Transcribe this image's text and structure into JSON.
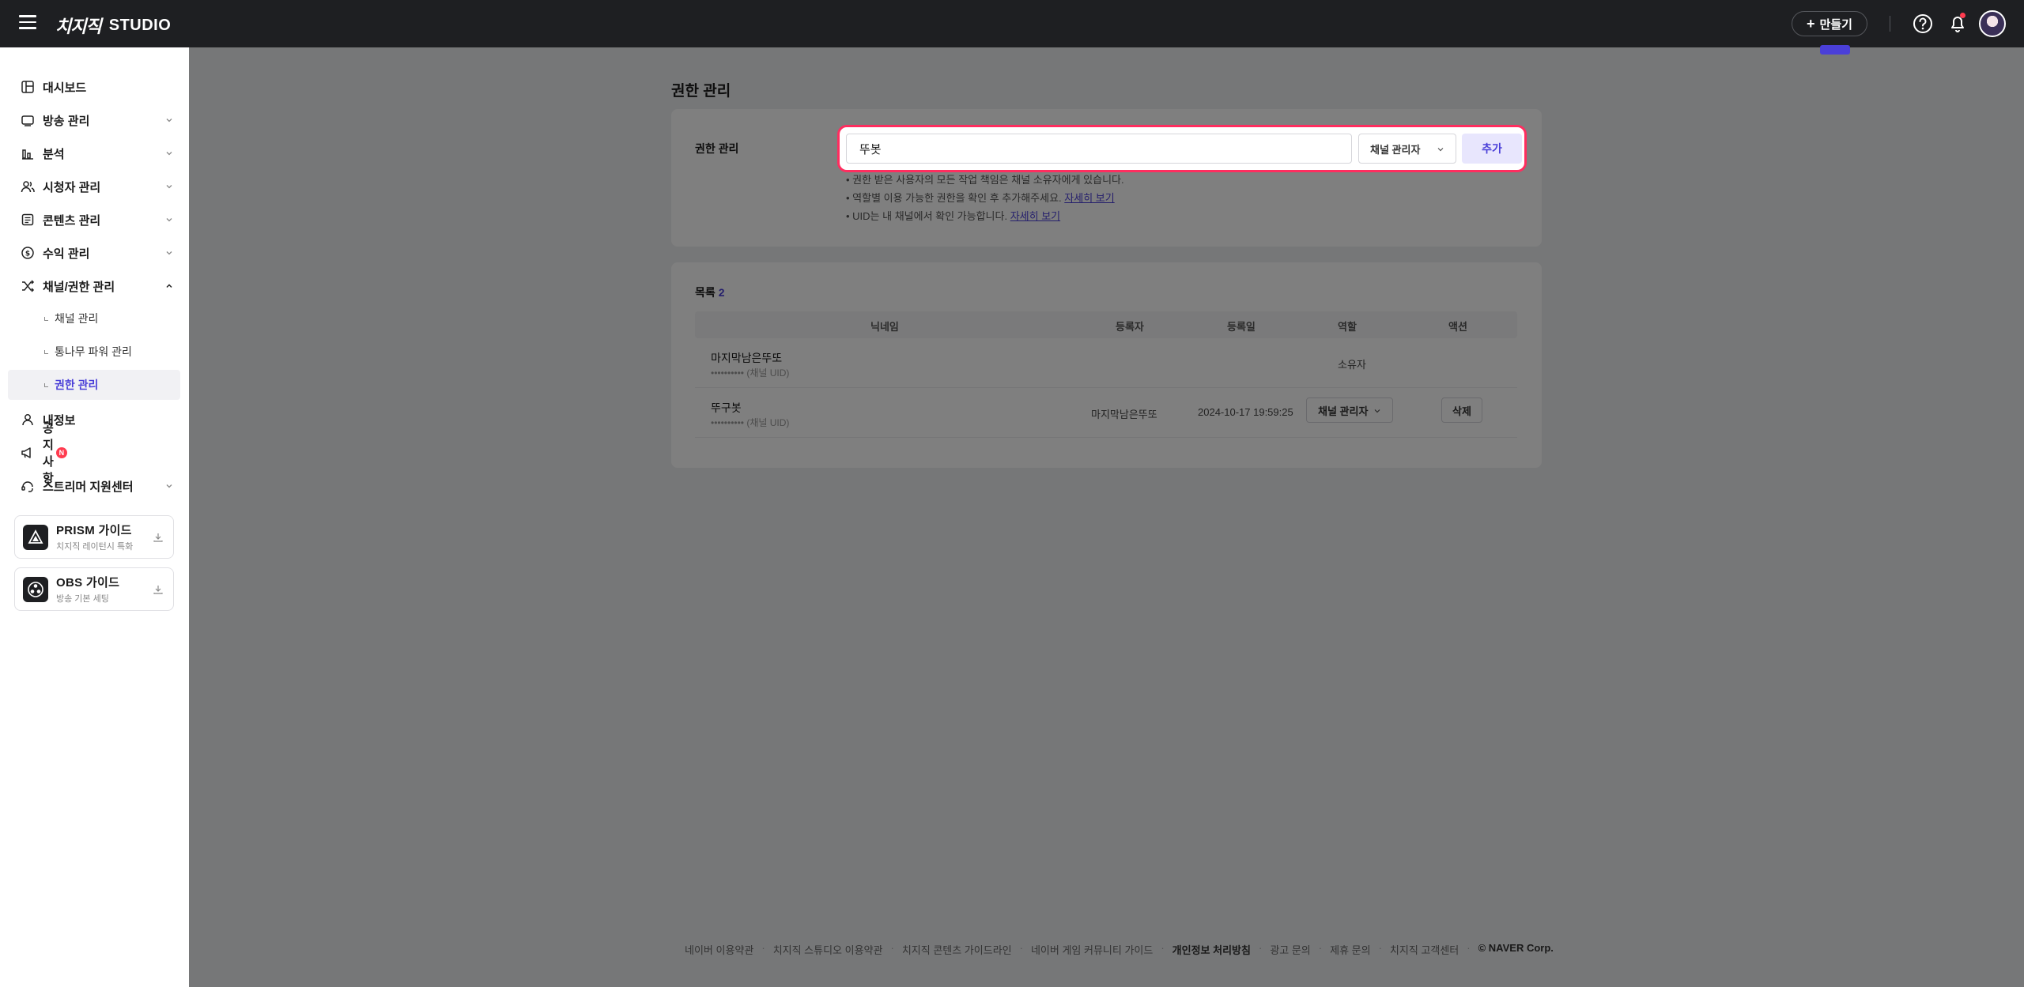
{
  "topbar": {
    "logo_mark": "치지직",
    "logo_studio": "STUDIO",
    "create_label": "만들기"
  },
  "sidebar": {
    "items": [
      {
        "label": "대시보드",
        "icon": "dashboard-icon"
      },
      {
        "label": "방송 관리",
        "icon": "broadcast-icon"
      },
      {
        "label": "분석",
        "icon": "analytics-icon"
      },
      {
        "label": "시청자 관리",
        "icon": "viewer-icon"
      },
      {
        "label": "콘텐츠 관리",
        "icon": "content-icon"
      },
      {
        "label": "수익 관리",
        "icon": "revenue-icon"
      },
      {
        "label": "채널/권한 관리",
        "icon": "shuffle-icon"
      }
    ],
    "sub_items": [
      {
        "label": "채널 관리"
      },
      {
        "label": "통나무 파워 관리"
      },
      {
        "label": "권한 관리"
      }
    ],
    "items_bottom": [
      {
        "label": "내정보",
        "icon": "user-icon"
      },
      {
        "label": "공지사항",
        "icon": "megaphone-icon",
        "badge": "N"
      },
      {
        "label": "스트리머 지원센터",
        "icon": "headset-icon"
      }
    ],
    "guides": [
      {
        "title": "PRISM 가이드",
        "subtitle": "치지직 레이턴시 특화"
      },
      {
        "title": "OBS 가이드",
        "subtitle": "방송 기본 세팅"
      }
    ]
  },
  "page": {
    "title": "권한 관리",
    "form_label": "권한 관리",
    "input_value": "뚜봇",
    "role_select": "채널 관리자",
    "add_label": "추가",
    "notes": {
      "line1": "• 권한 받은 사용자의 모든 작업 책임은 채널 소유자에게 있습니다.",
      "line2": "• 역할별 이용 가능한 권한을 확인 후 추가해주세요.",
      "line2_link": "자세히 보기",
      "line3": "• UID는 내 채널에서 확인 가능합니다.",
      "line3_link": "자세히 보기"
    }
  },
  "list": {
    "title": "목록",
    "count": "2",
    "columns": [
      "닉네임",
      "등록자",
      "등록일",
      "역할",
      "액션"
    ],
    "rows": [
      {
        "nickname": "마지막남은뚜또",
        "uid": "•••••••••• (채널 UID)",
        "registrant": "",
        "date": "",
        "role": "소유자",
        "action": ""
      },
      {
        "nickname": "뚜구봇",
        "uid": "•••••••••• (채널 UID)",
        "registrant": "마지막남은뚜또",
        "date": "2024-10-17 19:59:25",
        "role": "채널 관리자",
        "action": "삭제"
      }
    ]
  },
  "footer": {
    "links": [
      "네이버 이용약관",
      "치지직 스튜디오 이용약관",
      "치지직 콘텐츠 가이드라인",
      "네이버 게임 커뮤니티 가이드",
      "개인정보 처리방침",
      "광고 문의",
      "제휴 문의",
      "치지직 고객센터"
    ],
    "copyright": "© NAVER Corp."
  },
  "colors": {
    "topbar": "#1e1f22",
    "accent": "#4a3fd8",
    "highlight": "#ff2d5f",
    "badge": "#ff3b4f"
  }
}
